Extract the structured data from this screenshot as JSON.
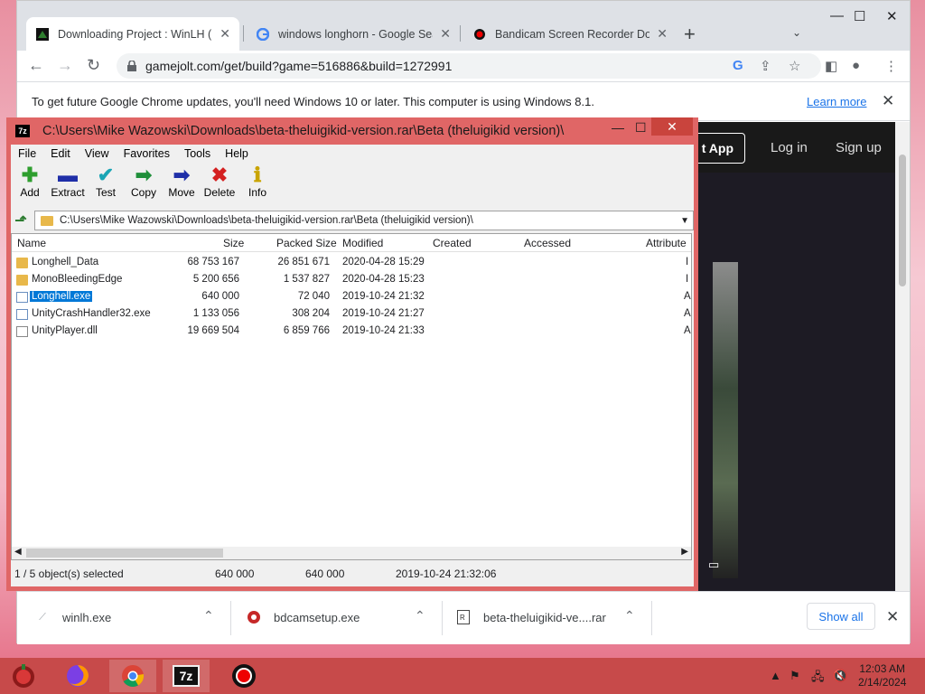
{
  "chrome": {
    "tabs": [
      {
        "title": "Downloading Project : WinLH (Fc",
        "active": true
      },
      {
        "title": "windows longhorn - Google Sear",
        "active": false
      },
      {
        "title": "Bandicam Screen Recorder Dowr",
        "active": false
      }
    ],
    "new_tab": "+",
    "url": "gamejolt.com/get/build?game=516886&build=1272991",
    "infobar": {
      "message": "To get future Google Chrome updates, you'll need Windows 10 or later. This computer is using Windows 8.1.",
      "learn_more": "Learn more"
    },
    "site_nav": {
      "get_app": "t App",
      "log_in": "Log in",
      "sign_up": "Sign up"
    },
    "downloads": [
      {
        "name": "winlh.exe"
      },
      {
        "name": "bdcamsetup.exe"
      },
      {
        "name": "beta-theluigikid-ve....rar"
      }
    ],
    "show_all": "Show all"
  },
  "sevenzip": {
    "title": "C:\\Users\\Mike Wazowski\\Downloads\\beta-theluigikid-version.rar\\Beta (theluigikid version)\\",
    "menu": [
      "File",
      "Edit",
      "View",
      "Favorites",
      "Tools",
      "Help"
    ],
    "tools": [
      {
        "label": "Add",
        "icon": "add-icon",
        "color": "#2e9e2e"
      },
      {
        "label": "Extract",
        "icon": "extract-icon",
        "color": "#1f2fa8"
      },
      {
        "label": "Test",
        "icon": "test-icon",
        "color": "#1aa5b5"
      },
      {
        "label": "Copy",
        "icon": "copy-icon",
        "color": "#1f8f3a"
      },
      {
        "label": "Move",
        "icon": "move-icon",
        "color": "#1f2fa8"
      },
      {
        "label": "Delete",
        "icon": "delete-icon",
        "color": "#d42020"
      },
      {
        "label": "Info",
        "icon": "info-icon",
        "color": "#c9a400"
      }
    ],
    "path": "C:\\Users\\Mike Wazowski\\Downloads\\beta-theluigikid-version.rar\\Beta (theluigikid version)\\",
    "columns": [
      "Name",
      "Size",
      "Packed Size",
      "Modified",
      "Created",
      "Accessed",
      "Attribute"
    ],
    "files": [
      {
        "name": "Longhell_Data",
        "size": "68 753 167",
        "packed": "26 851 671",
        "modified": "2020-04-28 15:29",
        "attr": "I",
        "type": "folder",
        "selected": false
      },
      {
        "name": "MonoBleedingEdge",
        "size": "5 200 656",
        "packed": "1 537 827",
        "modified": "2020-04-28 15:23",
        "attr": "I",
        "type": "folder",
        "selected": false
      },
      {
        "name": "Longhell.exe",
        "size": "640 000",
        "packed": "72 040",
        "modified": "2019-10-24 21:32",
        "attr": "A",
        "type": "exe",
        "selected": true
      },
      {
        "name": "UnityCrashHandler32.exe",
        "size": "1 133 056",
        "packed": "308 204",
        "modified": "2019-10-24 21:27",
        "attr": "A",
        "type": "exe",
        "selected": false
      },
      {
        "name": "UnityPlayer.dll",
        "size": "19 669 504",
        "packed": "6 859 766",
        "modified": "2019-10-24 21:33",
        "attr": "A",
        "type": "dll",
        "selected": false
      }
    ],
    "status": {
      "selection": "1 / 5 object(s) selected",
      "size": "640 000",
      "packed": "640 000",
      "modified": "2019-10-24 21:32:06"
    }
  },
  "taskbar": {
    "apps": [
      "firefox-icon",
      "chrome-icon",
      "7zip-icon",
      "bandicam-icon"
    ],
    "sevenzip_label": "7z",
    "time": "12:03 AM",
    "date": "2/14/2024"
  }
}
